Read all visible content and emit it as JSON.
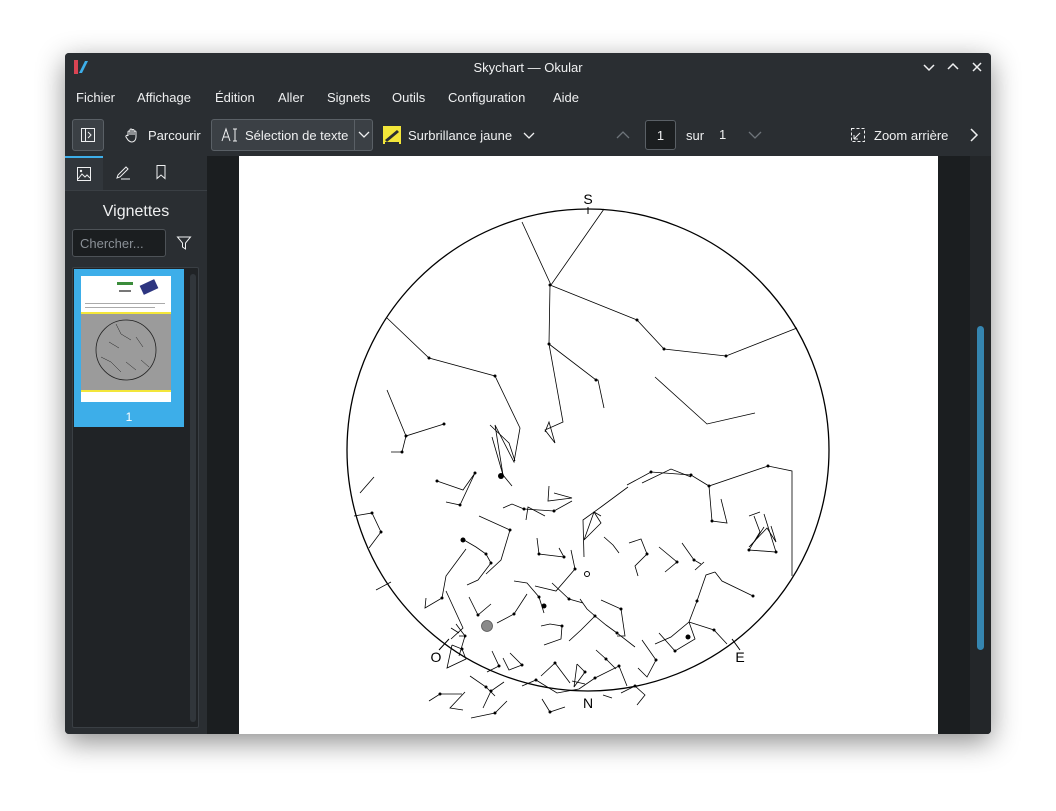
{
  "window": {
    "title": "Skychart — Okular"
  },
  "menu": [
    "Fichier",
    "Affichage",
    "Édition",
    "Aller",
    "Signets",
    "Outils",
    "Configuration",
    "Aide"
  ],
  "toolbar": {
    "browse": "Parcourir",
    "text_select": "Sélection de texte",
    "highlight": "Surbrillance jaune",
    "page_current": "1",
    "page_of": "sur",
    "page_total": "1",
    "zoom_out": "Zoom arrière"
  },
  "sidebar": {
    "panel_title": "Vignettes",
    "search_placeholder": "Chercher...",
    "thumbnail_label": "1"
  },
  "chart": {
    "directions": {
      "south": "S",
      "north": "N",
      "east": "E",
      "west": "O"
    }
  },
  "colors": {
    "accent": "#3daee9",
    "window_bg": "#2a2e32",
    "highlight_yellow": "#f3e63a"
  }
}
